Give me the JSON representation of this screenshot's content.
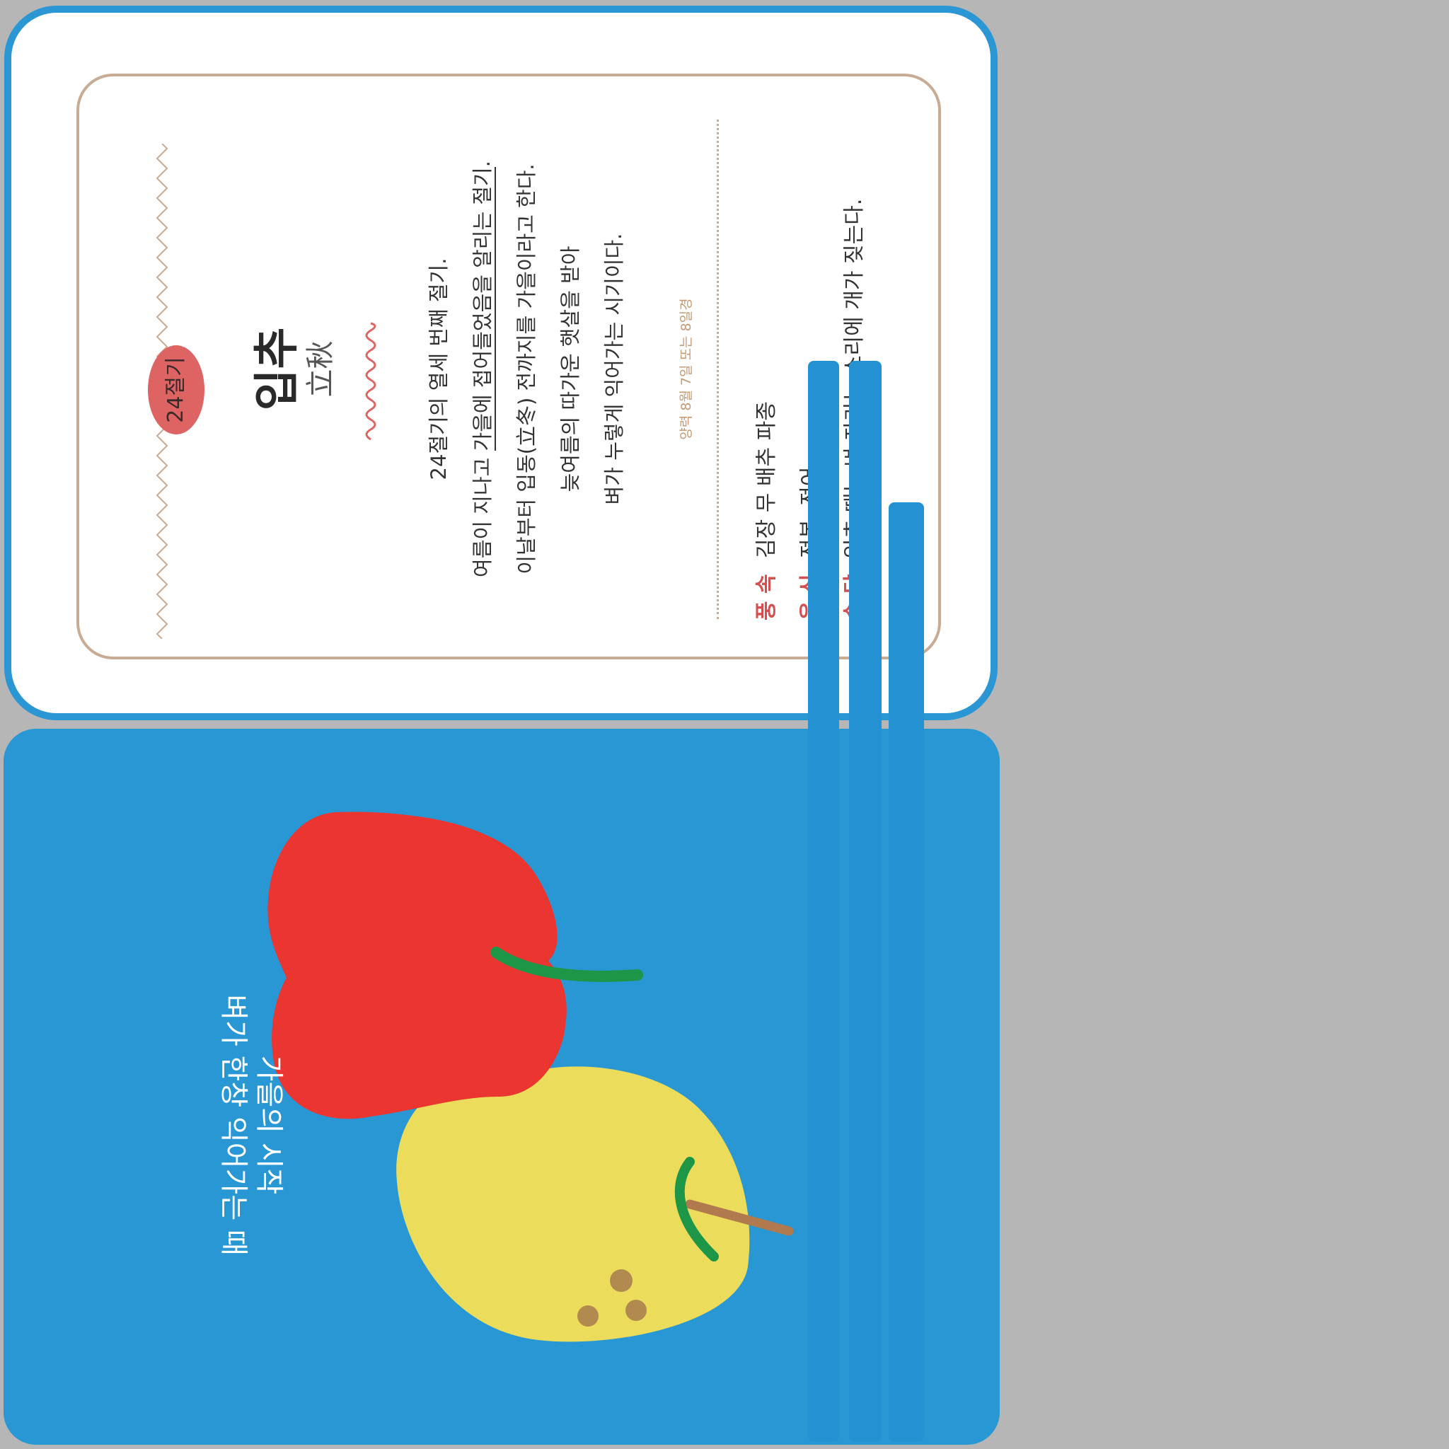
{
  "badge": "24절기",
  "title": "입추",
  "hanja": "立秋",
  "description": {
    "line1": "24절기의 열세 번째 절기.",
    "line2_pre": "여름이 지나고 ",
    "line2_hl": "가을에 접어들었음을 알리는 절기",
    "line2_post": ".",
    "line3": "이날부터 입동(立冬) 전까지를 가을이라고 한다.",
    "line4": "늦여름의 따가운 햇살을 받아",
    "line5": "벼가 누렇게 익어가는 시기이다."
  },
  "date": "양력 8월 7일 또는 8일경",
  "rows": [
    {
      "label": "풍 속",
      "value": "김장 무 배추 파종"
    },
    {
      "label": "음 식",
      "value": "전복, 전어"
    },
    {
      "label": "속 담",
      "value": "입추 때는 벼 자라는 소리에 개가 짖는다."
    }
  ],
  "caption": {
    "line1": "가을의 시작",
    "line2": "벼가 한창 익어가는 때"
  },
  "colors": {
    "card_blue": "#2897d4",
    "badge_red": "#dd6462",
    "apple_red": "#ea3530",
    "pear_yellow": "#ebdd5b",
    "stem_green": "#1e9648",
    "stem_brown": "#b07a4e",
    "frame_tan": "#c8ab94"
  },
  "icons": [
    "apple-illustration",
    "pear-illustration"
  ]
}
